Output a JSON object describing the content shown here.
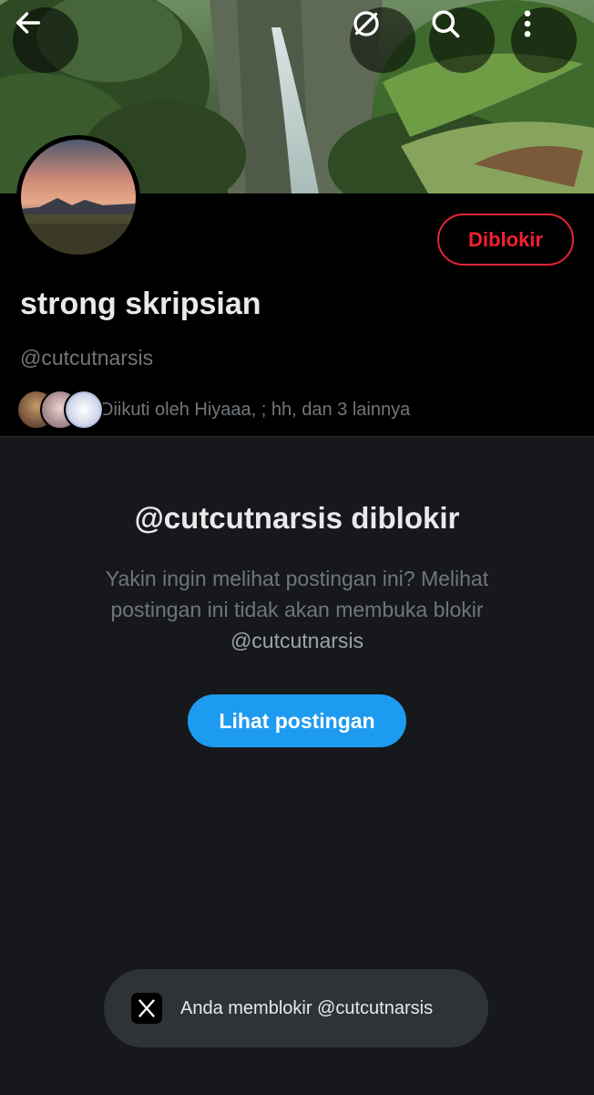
{
  "header": {
    "back_icon": "arrow-left-icon",
    "grok_icon": "grok-icon",
    "search_icon": "search-icon",
    "more_icon": "more-vertical-icon"
  },
  "profile": {
    "display_name": "strong skripsian",
    "handle": "@cutcutnarsis",
    "blocked_button_label": "Diblokir",
    "followers_text": "Diikuti oleh Hiyaaa, ; hh, dan 3 lainnya"
  },
  "blocked_notice": {
    "title": "@cutcutnarsis diblokir",
    "description_line1": "Yakin ingin melihat postingan ini? Melihat",
    "description_line2": "postingan ini tidak akan membuka blokir",
    "description_handle": "@cutcutnarsis",
    "view_button_label": "Lihat postingan"
  },
  "toast": {
    "icon": "x-logo-icon",
    "message": "Anda memblokir @cutcutnarsis"
  },
  "colors": {
    "accent_blue": "#1d9bf0",
    "danger_red": "#f4212e",
    "background": "#000000",
    "panel": "#16181c"
  }
}
